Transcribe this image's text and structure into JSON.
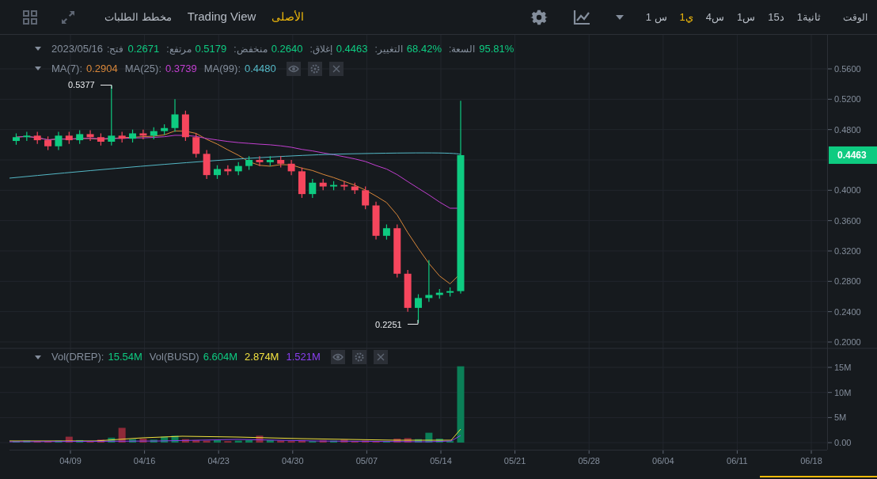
{
  "toolbar": {
    "views": [
      {
        "label": "الأصلى",
        "selected": true
      },
      {
        "label": "Trading View",
        "selected": false
      },
      {
        "label": "مخطط الطلبات",
        "selected": false
      }
    ],
    "time_label": "الوقت",
    "intervals": [
      {
        "label": "1ثانية",
        "selected": false
      },
      {
        "label": "15د",
        "selected": false
      },
      {
        "label": "1س",
        "selected": false
      },
      {
        "label": "4س",
        "selected": false
      },
      {
        "label": "1ي",
        "selected": true
      },
      {
        "label": "1 س",
        "selected": false
      }
    ]
  },
  "ohlc_legend": {
    "date": "2023/05/16",
    "open": {
      "label": "فتح:",
      "value": "0.2671"
    },
    "high": {
      "label": "مرتفع:",
      "value": "0.5179"
    },
    "low": {
      "label": "منخفض:",
      "value": "0.2640"
    },
    "close": {
      "label": "إغلاق:",
      "value": "0.4463"
    },
    "change": {
      "label": "التغيير:",
      "value": "68.42%"
    },
    "amplitude": {
      "label": "السعة:",
      "value": "95.81%"
    }
  },
  "ma_legend": [
    {
      "label": "MA(7):",
      "value": "0.2904",
      "color": "#d9873a"
    },
    {
      "label": "MA(25):",
      "value": "0.3739",
      "color": "#c23fd0"
    },
    {
      "label": "MA(99):",
      "value": "0.4480",
      "color": "#54b8c6"
    }
  ],
  "volume_legend": {
    "label": "Vol(DREP):",
    "value": "15.54M",
    "label_2": "Vol(BUSD)",
    "values": [
      {
        "value": "6.604M",
        "color": "#0ecb81"
      },
      {
        "value": "2.874M",
        "color": "#f0e040"
      },
      {
        "value": "1.521M",
        "color": "#8a3ff0"
      }
    ]
  },
  "price_axis": {
    "ticks": [
      "0.5600",
      "0.5200",
      "0.4800",
      "0.4000",
      "0.3600",
      "0.3200",
      "0.2800",
      "0.2400",
      "0.2000"
    ],
    "current_price": "0.4463"
  },
  "volume_axis": {
    "ticks": [
      "15M",
      "10M",
      "5M",
      "0.00"
    ]
  },
  "time_axis": {
    "ticks": [
      "04/09",
      "04/16",
      "04/23",
      "04/30",
      "05/07",
      "05/14",
      "05/21",
      "05/28",
      "06/04",
      "06/11",
      "06/18"
    ]
  },
  "annotations": {
    "high": "0.5377",
    "low": "0.2251"
  }
}
